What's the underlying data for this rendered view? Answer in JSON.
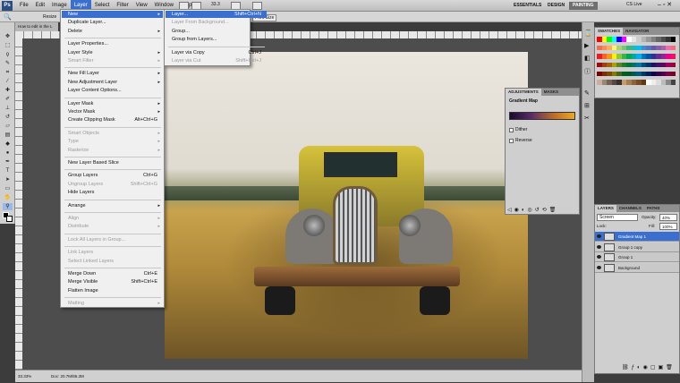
{
  "app": {
    "logo": "Ps"
  },
  "menubar": {
    "items": [
      "File",
      "Edit",
      "Image",
      "Layer",
      "Select",
      "Filter",
      "View",
      "Window",
      "Help"
    ],
    "zoom": "33.3",
    "workspaces": [
      "ESSENTIALS",
      "DESIGN",
      "PAINTING"
    ],
    "cslive": "CS Live"
  },
  "optionsbar": {
    "resize_label": "Resize",
    "print_size": "Print Size"
  },
  "doc_tab": "How to edit in the L",
  "layer_menu": [
    {
      "label": "New",
      "arrow": "▸",
      "state": "hl"
    },
    {
      "label": "Duplicate Layer..."
    },
    {
      "label": "Delete",
      "arrow": "▸"
    },
    {
      "sep": true
    },
    {
      "label": "Layer Properties..."
    },
    {
      "label": "Layer Style",
      "arrow": "▸"
    },
    {
      "label": "Smart Filter",
      "arrow": "▸",
      "state": "dis"
    },
    {
      "sep": true
    },
    {
      "label": "New Fill Layer",
      "arrow": "▸"
    },
    {
      "label": "New Adjustment Layer",
      "arrow": "▸"
    },
    {
      "label": "Layer Content Options..."
    },
    {
      "sep": true
    },
    {
      "label": "Layer Mask",
      "arrow": "▸"
    },
    {
      "label": "Vector Mask",
      "arrow": "▸"
    },
    {
      "label": "Create Clipping Mask",
      "shortcut": "Alt+Ctrl+G"
    },
    {
      "sep": true
    },
    {
      "label": "Smart Objects",
      "arrow": "▸",
      "state": "dis"
    },
    {
      "label": "Type",
      "arrow": "▸",
      "state": "dis"
    },
    {
      "label": "Rasterize",
      "arrow": "▸",
      "state": "dis"
    },
    {
      "sep": true
    },
    {
      "label": "New Layer Based Slice"
    },
    {
      "sep": true
    },
    {
      "label": "Group Layers",
      "shortcut": "Ctrl+G"
    },
    {
      "label": "Ungroup Layers",
      "shortcut": "Shift+Ctrl+G",
      "state": "dis"
    },
    {
      "label": "Hide Layers"
    },
    {
      "sep": true
    },
    {
      "label": "Arrange",
      "arrow": "▸"
    },
    {
      "sep": true
    },
    {
      "label": "Align",
      "arrow": "▸",
      "state": "dis"
    },
    {
      "label": "Distribute",
      "arrow": "▸",
      "state": "dis"
    },
    {
      "sep": true
    },
    {
      "label": "Lock All Layers in Group...",
      "state": "dis"
    },
    {
      "sep": true
    },
    {
      "label": "Link Layers",
      "state": "dis"
    },
    {
      "label": "Select Linked Layers",
      "state": "dis"
    },
    {
      "sep": true
    },
    {
      "label": "Merge Down",
      "shortcut": "Ctrl+E"
    },
    {
      "label": "Merge Visible",
      "shortcut": "Shift+Ctrl+E"
    },
    {
      "label": "Flatten Image"
    },
    {
      "sep": true
    },
    {
      "label": "Matting",
      "arrow": "▸",
      "state": "dis"
    }
  ],
  "new_submenu": [
    {
      "label": "Layer...",
      "shortcut": "Shift+Ctrl+N",
      "state": "hl"
    },
    {
      "label": "Layer From Background...",
      "state": "dis"
    },
    {
      "label": "Group..."
    },
    {
      "label": "Group from Layers..."
    },
    {
      "sep": true
    },
    {
      "label": "Layer via Copy",
      "shortcut": "Ctrl+J"
    },
    {
      "label": "Layer via Cut",
      "shortcut": "Shift+Ctrl+J",
      "state": "dis"
    }
  ],
  "adjustments": {
    "tabs": [
      "ADJUSTMENTS",
      "MASKS"
    ],
    "title": "Gradient Map",
    "dither": "Dither",
    "reverse": "Reverse"
  },
  "swatches": {
    "tabs": [
      "SWATCHES",
      "NAVIGATOR"
    ],
    "colors": [
      "#ff0000",
      "#ffff00",
      "#00ff00",
      "#00ffff",
      "#0000ff",
      "#ff00ff",
      "#ffffff",
      "#e6e6e6",
      "#cccccc",
      "#b3b3b3",
      "#999999",
      "#808080",
      "#666666",
      "#4d4d4d",
      "#333333",
      "#000000",
      "#f26c4f",
      "#f68e56",
      "#fbaf5d",
      "#fff568",
      "#acd373",
      "#7cc576",
      "#3bb878",
      "#1abbb4",
      "#00bff3",
      "#438ccb",
      "#5574b9",
      "#605ca8",
      "#855fa8",
      "#a763a8",
      "#f06eaa",
      "#f26d7d",
      "#ed1c24",
      "#f26522",
      "#f7941d",
      "#fff200",
      "#8dc63f",
      "#39b54a",
      "#00a651",
      "#00a99d",
      "#00aeef",
      "#0072bc",
      "#0054a6",
      "#2e3192",
      "#662d91",
      "#92278f",
      "#ec008c",
      "#ed145b",
      "#9e0b0f",
      "#a0410d",
      "#a36209",
      "#aba000",
      "#598527",
      "#1a7b30",
      "#007236",
      "#00746b",
      "#0076a3",
      "#004b80",
      "#003471",
      "#1b1464",
      "#440e62",
      "#630460",
      "#9e005d",
      "#9e0039",
      "#790000",
      "#7b2e00",
      "#7d4900",
      "#827b00",
      "#406618",
      "#005e20",
      "#005826",
      "#005952",
      "#005b7f",
      "#003663",
      "#002157",
      "#0d004c",
      "#32004b",
      "#4b0049",
      "#7b0046",
      "#7a0026",
      "#c7b299",
      "#998675",
      "#736357",
      "#534741",
      "#37302d",
      "#c69c6d",
      "#a67c52",
      "#8c6239",
      "#754c24",
      "#603913",
      "#ffffff",
      "#eeeeee",
      "#dddddd",
      "#bbbbbb",
      "#888888",
      "#444444"
    ]
  },
  "layers": {
    "tabs": [
      "LAYERS",
      "CHANNELS",
      "PATHS"
    ],
    "blend": "Screen",
    "opacity_label": "Opacity:",
    "opacity": "40%",
    "lock_label": "Lock:",
    "fill_label": "Fill:",
    "fill": "100%",
    "rows": [
      {
        "name": "Gradient Map 1",
        "selected": true
      },
      {
        "name": "Group 1 copy",
        "selected": false
      },
      {
        "name": "Group 1",
        "selected": false
      },
      {
        "name": "Background",
        "selected": false
      }
    ]
  },
  "status": {
    "zoom": "33.33%",
    "doc": "Doc: 20.7M/86.3M"
  }
}
